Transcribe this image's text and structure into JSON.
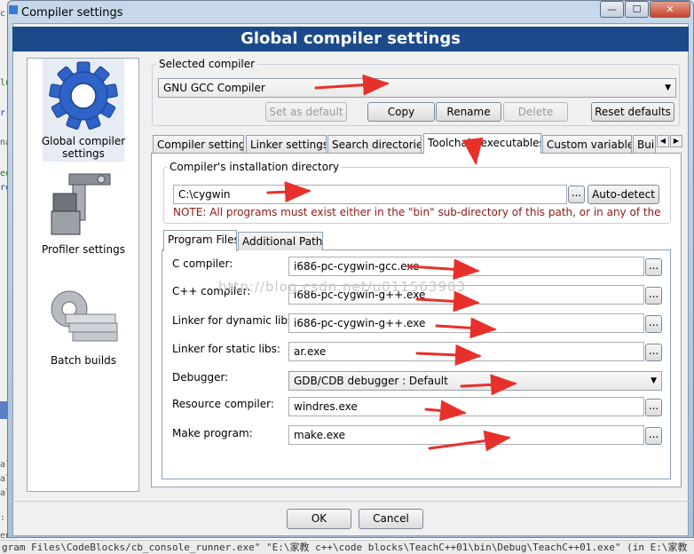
{
  "window": {
    "title": "Compiler settings",
    "min": "—",
    "max": "☐",
    "close": "✕"
  },
  "header": {
    "title": "Global compiler settings"
  },
  "sidebar": {
    "items": [
      {
        "label": "Global compiler settings",
        "icon": "gear-icon"
      },
      {
        "label": "Profiler settings",
        "icon": "profiler-icon"
      },
      {
        "label": "Batch builds",
        "icon": "batch-icon"
      }
    ]
  },
  "selected_compiler": {
    "group_label": "Selected compiler",
    "value": "GNU GCC Compiler",
    "buttons": {
      "set_default": "Set as default",
      "copy": "Copy",
      "rename": "Rename",
      "delete": "Delete",
      "reset_defaults": "Reset defaults"
    }
  },
  "tabs": [
    {
      "label": "Compiler settings"
    },
    {
      "label": "Linker settings"
    },
    {
      "label": "Search directories"
    },
    {
      "label": "Toolchain executables",
      "active": true
    },
    {
      "label": "Custom variables"
    },
    {
      "label": "Bui"
    }
  ],
  "install_dir": {
    "group_label": "Compiler's installation directory",
    "value": "C:\\cygwin",
    "browse": "...",
    "auto_detect": "Auto-detect",
    "note": "NOTE: All programs must exist either in the \"bin\" sub-directory of this path, or in any of the"
  },
  "subtabs": [
    {
      "label": "Program Files",
      "active": true
    },
    {
      "label": "Additional Paths"
    }
  ],
  "programs": [
    {
      "label": "C compiler:",
      "value": "i686-pc-cygwin-gcc.exe"
    },
    {
      "label": "C++ compiler:",
      "value": "i686-pc-cygwin-g++.exe"
    },
    {
      "label": "Linker for dynamic libs:",
      "value": "i686-pc-cygwin-g++.exe"
    },
    {
      "label": "Linker for static libs:",
      "value": "ar.exe"
    },
    {
      "label": "Debugger:",
      "value": "GDB/CDB debugger : Default"
    },
    {
      "label": "Resource compiler:",
      "value": "windres.exe"
    },
    {
      "label": "Make program:",
      "value": "make.exe"
    }
  ],
  "browse_label": "...",
  "footer": {
    "ok": "OK",
    "cancel": "Cancel"
  },
  "watermark": "http://blog.csdn.net/u011563903",
  "background": {
    "status_text": "gram Files\\CodeBlocks/cb_console_runner.exe\" \"E:\\家教 c++\\code blocks\\TeachC++01\\bin\\Debug\\TeachC++01.exe\"  (in E:\\家教 c++",
    "fragments": [
      "c in",
      "luc",
      "r",
      "nai",
      "eot",
      "ret",
      "ali",
      "ali",
      "ali",
      ": I",
      "end"
    ]
  },
  "colors": {
    "header_bg": "#1a4a8a",
    "note_text": "#8b1a1a",
    "annotation_arrow": "#e8302a"
  }
}
